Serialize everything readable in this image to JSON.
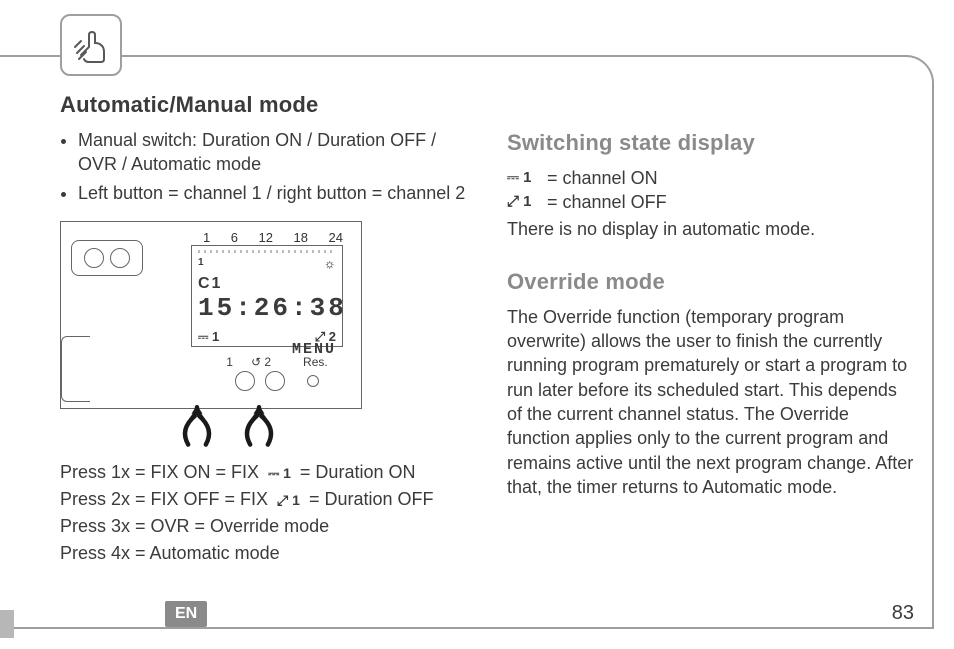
{
  "header": {
    "icon": "finger-press-icon"
  },
  "left": {
    "title": "Automatic/Manual mode",
    "bullets": [
      "Manual switch: Duration ON / Duration OFF / OVR / Automatic mode",
      "Left button = channel 1 / right button = channel 2"
    ],
    "device": {
      "scale": [
        "1",
        "6",
        "12",
        "18",
        "24"
      ],
      "channel_label": "C1",
      "sun_icon": "☼",
      "time": "15:26:38",
      "sw1": "⎓ 1",
      "sw2": "⤢ 2",
      "menu": "MENU",
      "button_labels": {
        "one": "1",
        "two": "2",
        "res": "Res."
      }
    },
    "press": {
      "l1a": "Press 1x = FIX ON = FIX ",
      "l1_icon": "⎓ 1",
      "l1b": " = Duration ON",
      "l2a": "Press 2x = FIX OFF = FIX ",
      "l2_icon": "⤢ 1",
      "l2b": " = Duration OFF",
      "l3": "Press 3x = OVR = Override mode",
      "l4": "Press 4x = Automatic mode"
    }
  },
  "right": {
    "switching_title": "Switching state display",
    "on_icon": "⎓ 1",
    "on_text": " = channel ON",
    "off_icon": "⤢ 1",
    "off_text": " = channel OFF",
    "auto_note": "There is no display in automatic mode.",
    "override_title": "Override mode",
    "override_body": "The Override function (temporary program overwrite) allows the user to finish the currently running program prematurely or start a program to run later before its scheduled start. This depends of the current channel status. The Override function applies only to the current program and remains active until the next program change. After that, the timer returns to Automatic mode."
  },
  "footer": {
    "lang": "EN",
    "page": "83"
  }
}
